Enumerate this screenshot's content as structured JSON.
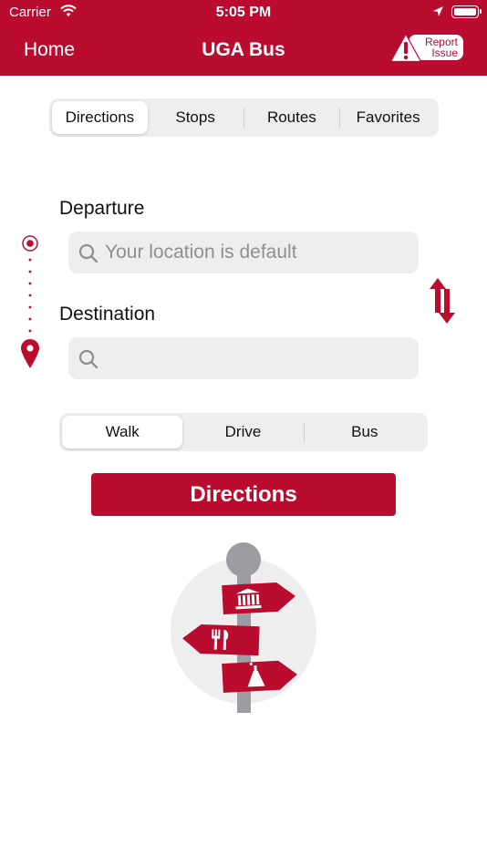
{
  "status_bar": {
    "carrier": "Carrier",
    "time": "5:05 PM"
  },
  "nav": {
    "home": "Home",
    "title": "UGA Bus",
    "report_line1": "Report",
    "report_line2": "Issue"
  },
  "tabs": {
    "items": [
      "Directions",
      "Stops",
      "Routes",
      "Favorites"
    ],
    "selected": "Directions"
  },
  "form": {
    "departure_label": "Departure",
    "departure_placeholder": "Your location is default",
    "destination_label": "Destination",
    "destination_placeholder": ""
  },
  "modes": {
    "items": [
      "Walk",
      "Drive",
      "Bus"
    ],
    "selected": "Walk"
  },
  "directions_button": "Directions",
  "colors": {
    "accent": "#ba0c2f",
    "segment_bg": "#eeeeef",
    "signpost_pole": "#9b9da2",
    "signpost_circle": "#eeeeee"
  },
  "icons": [
    "wifi-icon",
    "location-arrow-icon",
    "battery-icon",
    "warning-icon",
    "search-icon",
    "origin-marker-icon",
    "destination-pin-icon",
    "swap-icon",
    "museum-icon",
    "fork-knife-icon",
    "flask-icon"
  ]
}
